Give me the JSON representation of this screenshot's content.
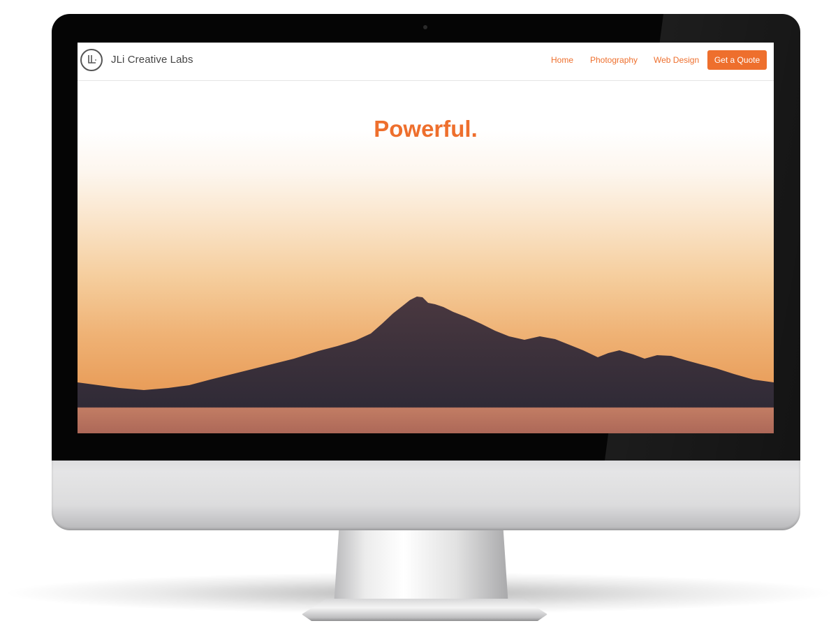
{
  "site": {
    "brand": "JLi Creative Labs",
    "logo_icon": "jl-monogram-logo",
    "nav": [
      {
        "label": "Home"
      },
      {
        "label": "Photography"
      },
      {
        "label": "Web Design"
      }
    ],
    "cta_label": "Get a Quote"
  },
  "hero": {
    "headline": "Powerful.",
    "image": "mountain-silhouette-at-sunset"
  },
  "colors": {
    "accent": "#ee6f2d",
    "brand_text": "#444444",
    "bezel": "#050505",
    "mountain": "#3a2f3b",
    "ground": "#b9715f"
  }
}
